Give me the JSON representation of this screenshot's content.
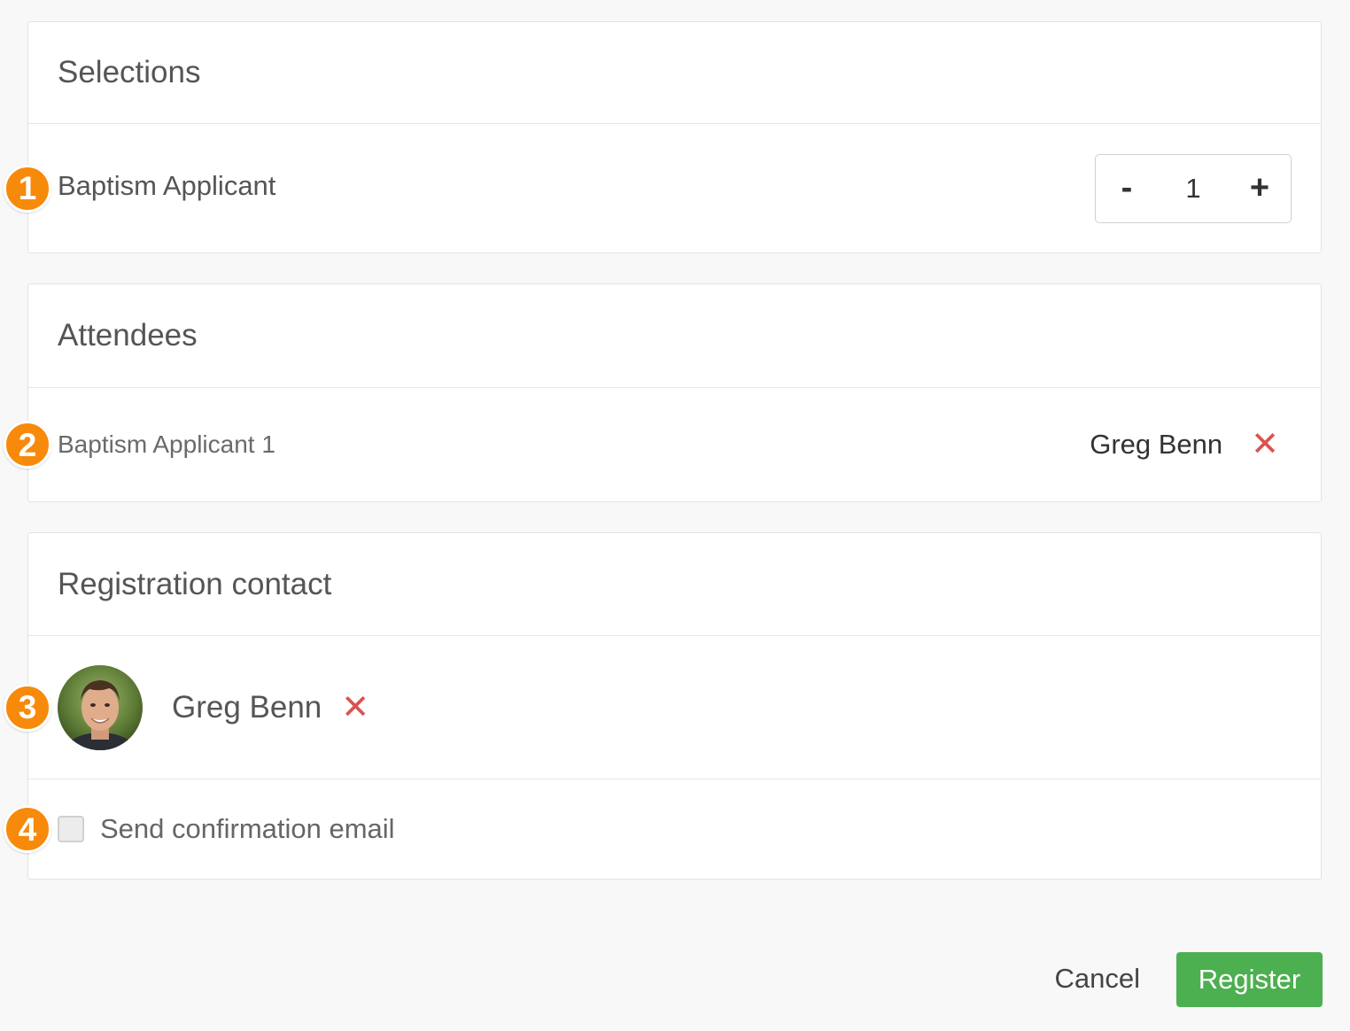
{
  "selections": {
    "title": "Selections",
    "item": {
      "badge": "1",
      "label": "Baptism Applicant",
      "minus": "-",
      "quantity": "1",
      "plus": "+"
    }
  },
  "attendees": {
    "title": "Attendees",
    "item": {
      "badge": "2",
      "label": "Baptism Applicant 1",
      "name": "Greg Benn",
      "remove": "✕"
    }
  },
  "contact": {
    "title": "Registration contact",
    "badge": "3",
    "name": "Greg Benn",
    "remove": "✕",
    "confirmation": {
      "badge": "4",
      "label": "Send confirmation email",
      "checked": false
    }
  },
  "footer": {
    "cancel": "Cancel",
    "register": "Register"
  },
  "colors": {
    "accent_badge": "#f78a0a",
    "register": "#4caf50",
    "remove": "#d9534f"
  }
}
